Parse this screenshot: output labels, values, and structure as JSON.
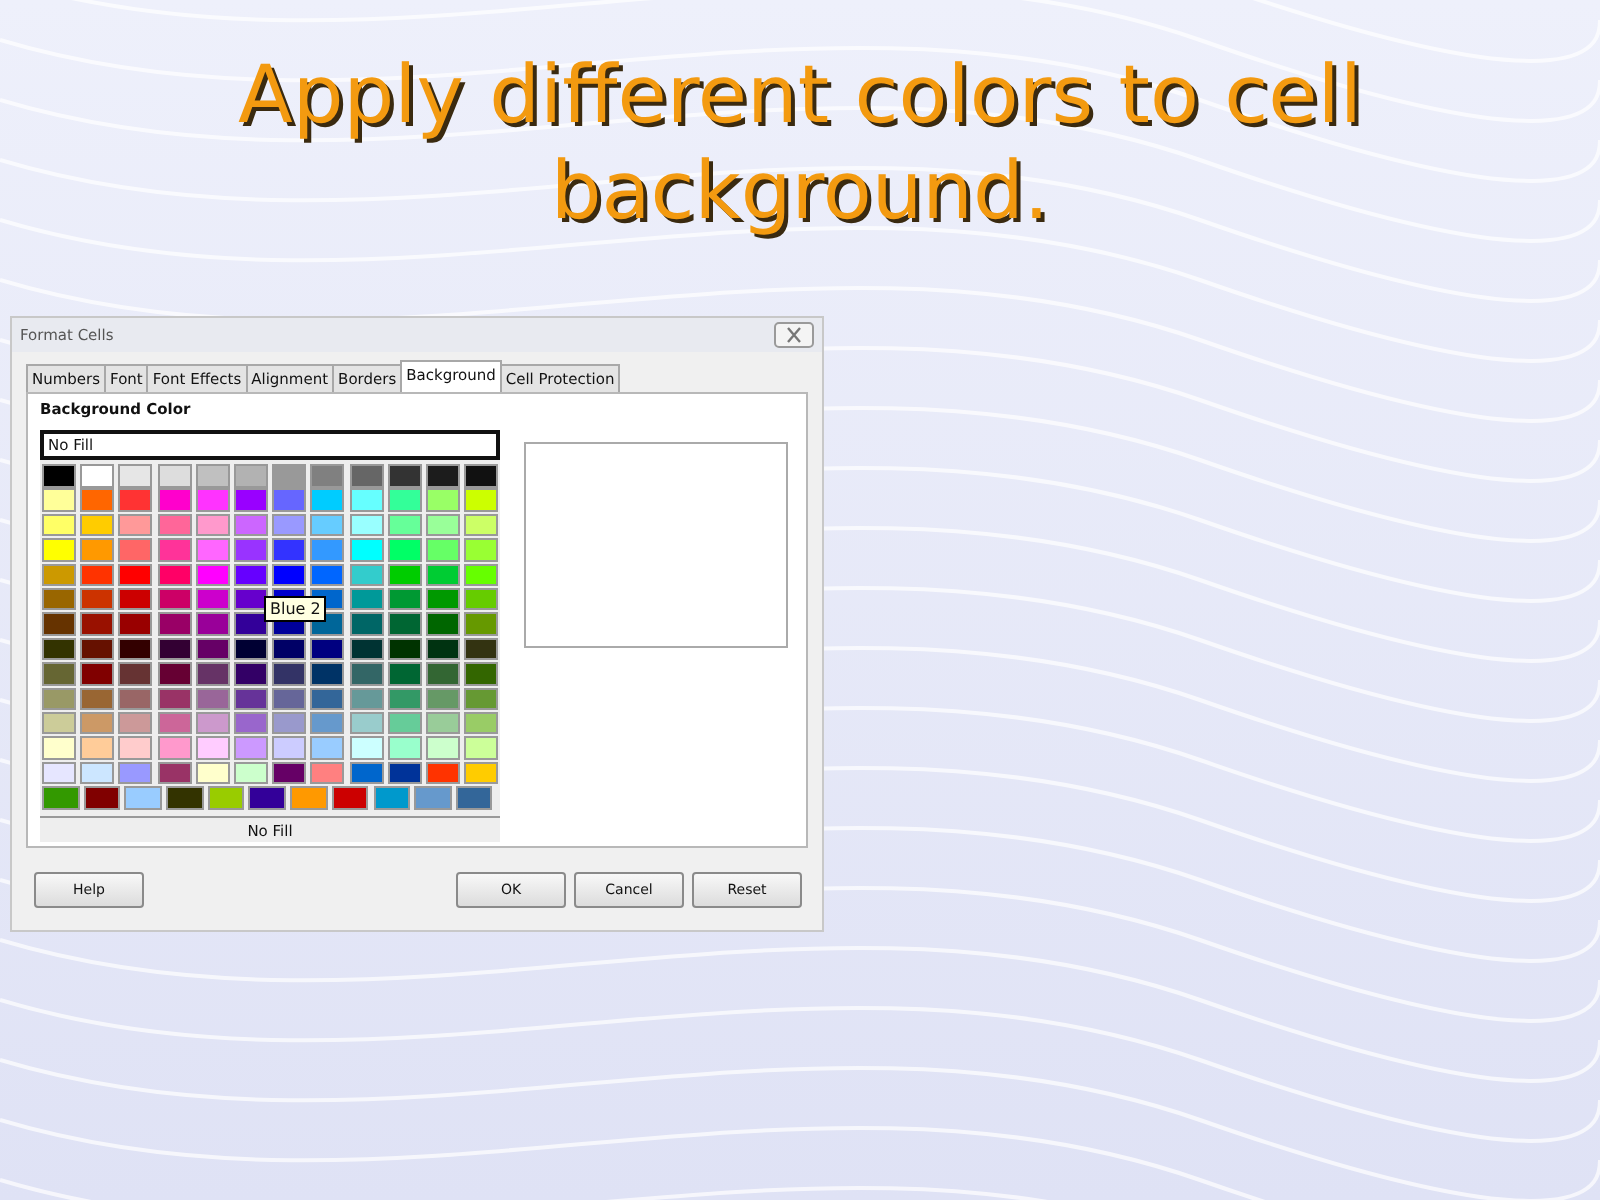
{
  "slide_title": "Apply different colors to cell background.",
  "dialog": {
    "title": "Format Cells",
    "tabs": [
      {
        "label": "Numbers",
        "selected": false
      },
      {
        "label": "Font",
        "selected": false
      },
      {
        "label": "Font Effects",
        "selected": false
      },
      {
        "label": "Alignment",
        "selected": false
      },
      {
        "label": "Borders",
        "selected": false
      },
      {
        "label": "Background",
        "selected": true
      },
      {
        "label": "Cell Protection",
        "selected": false
      }
    ],
    "section_title": "Background Color",
    "selected_color_name": "No Fill",
    "palette": [
      {
        "swatches": [
          {
            "color": "#000000"
          },
          {
            "color": "#ffffff"
          },
          {
            "color": "#e6e6e6"
          },
          {
            "color": "#dddddd"
          },
          {
            "color": "#c0c0c0"
          },
          {
            "color": "#b2b2b2"
          },
          {
            "color": "#999999"
          },
          {
            "color": "#808080"
          },
          {
            "color": "#666666"
          },
          {
            "color": "#333333"
          },
          {
            "color": "#1c1c1c"
          },
          {
            "color": "#111111"
          }
        ]
      },
      {
        "swatches": [
          {
            "color": "#ffff99"
          },
          {
            "color": "#ff6600"
          },
          {
            "color": "#ff3333"
          },
          {
            "color": "#ff00cc"
          },
          {
            "color": "#ff33ff"
          },
          {
            "color": "#9900ff"
          },
          {
            "color": "#6666ff"
          },
          {
            "color": "#00ccff"
          },
          {
            "color": "#66ffff"
          },
          {
            "color": "#33ff99"
          },
          {
            "color": "#99ff66"
          },
          {
            "color": "#ccff00"
          }
        ]
      },
      {
        "swatches": [
          {
            "color": "#ffff66"
          },
          {
            "color": "#ffcc00"
          },
          {
            "color": "#ff9999"
          },
          {
            "color": "#ff6699"
          },
          {
            "color": "#ff99cc"
          },
          {
            "color": "#cc66ff"
          },
          {
            "color": "#9999ff"
          },
          {
            "color": "#66ccff"
          },
          {
            "color": "#99ffff"
          },
          {
            "color": "#66ff99"
          },
          {
            "color": "#99ff99"
          },
          {
            "color": "#ccff66"
          }
        ]
      },
      {
        "swatches": [
          {
            "color": "#ffff00"
          },
          {
            "color": "#ff9900"
          },
          {
            "color": "#ff6666"
          },
          {
            "color": "#ff3399"
          },
          {
            "color": "#ff66ff"
          },
          {
            "color": "#9933ff"
          },
          {
            "color": "#3333ff"
          },
          {
            "color": "#3399ff"
          },
          {
            "color": "#00ffff"
          },
          {
            "color": "#00ff66"
          },
          {
            "color": "#66ff66"
          },
          {
            "color": "#99ff33"
          }
        ]
      },
      {
        "swatches": [
          {
            "color": "#cc9900"
          },
          {
            "color": "#ff3300"
          },
          {
            "color": "#ff0000"
          },
          {
            "color": "#ff0066"
          },
          {
            "color": "#ff00ff"
          },
          {
            "color": "#6600ff"
          },
          {
            "color": "#0000ff"
          },
          {
            "color": "#0066ff"
          },
          {
            "color": "#33cccc"
          },
          {
            "color": "#00cc00"
          },
          {
            "color": "#00cc33"
          },
          {
            "color": "#66ff00"
          }
        ]
      },
      {
        "swatches": [
          {
            "color": "#996600"
          },
          {
            "color": "#cc3300"
          },
          {
            "color": "#cc0000"
          },
          {
            "color": "#cc0066"
          },
          {
            "color": "#cc00cc"
          },
          {
            "color": "#6600cc"
          },
          {
            "color": "#0000cc"
          },
          {
            "color": "#0066cc"
          },
          {
            "color": "#009999"
          },
          {
            "color": "#009933"
          },
          {
            "color": "#009900"
          },
          {
            "color": "#66cc00"
          }
        ]
      },
      {
        "swatches": [
          {
            "color": "#663300"
          },
          {
            "color": "#991100"
          },
          {
            "color": "#990000"
          },
          {
            "color": "#990066"
          },
          {
            "color": "#990099"
          },
          {
            "color": "#330099"
          },
          {
            "color": "#000099"
          },
          {
            "color": "#006699"
          },
          {
            "color": "#006666"
          },
          {
            "color": "#006633"
          },
          {
            "color": "#006600"
          },
          {
            "color": "#669900"
          }
        ]
      },
      {
        "swatches": [
          {
            "color": "#333300"
          },
          {
            "color": "#661100"
          },
          {
            "color": "#330000"
          },
          {
            "color": "#330033"
          },
          {
            "color": "#660066"
          },
          {
            "color": "#000033"
          },
          {
            "color": "#000066"
          },
          {
            "color": "#000080"
          },
          {
            "color": "#003333"
          },
          {
            "color": "#003300"
          },
          {
            "color": "#003311"
          },
          {
            "color": "#333311"
          }
        ]
      },
      {
        "swatches": [
          {
            "color": "#666633"
          },
          {
            "color": "#800000"
          },
          {
            "color": "#663333"
          },
          {
            "color": "#660033"
          },
          {
            "color": "#663366"
          },
          {
            "color": "#330066"
          },
          {
            "color": "#333366"
          },
          {
            "color": "#003366"
          },
          {
            "color": "#336666"
          },
          {
            "color": "#006633"
          },
          {
            "color": "#336633"
          },
          {
            "color": "#336600"
          }
        ]
      },
      {
        "swatches": [
          {
            "color": "#999966"
          },
          {
            "color": "#996633"
          },
          {
            "color": "#996666"
          },
          {
            "color": "#993366"
          },
          {
            "color": "#996699"
          },
          {
            "color": "#663399"
          },
          {
            "color": "#666699"
          },
          {
            "color": "#336699"
          },
          {
            "color": "#669999"
          },
          {
            "color": "#339966"
          },
          {
            "color": "#669966"
          },
          {
            "color": "#669933"
          }
        ]
      },
      {
        "swatches": [
          {
            "color": "#cccc99"
          },
          {
            "color": "#cc9966"
          },
          {
            "color": "#cc9999"
          },
          {
            "color": "#cc6699"
          },
          {
            "color": "#cc99cc"
          },
          {
            "color": "#9966cc"
          },
          {
            "color": "#9999cc"
          },
          {
            "color": "#6699cc"
          },
          {
            "color": "#99cccc"
          },
          {
            "color": "#66cc99"
          },
          {
            "color": "#99cc99"
          },
          {
            "color": "#99cc66"
          }
        ]
      },
      {
        "swatches": [
          {
            "color": "#ffffcc"
          },
          {
            "color": "#ffcc99"
          },
          {
            "color": "#ffcccc"
          },
          {
            "color": "#ff99cc"
          },
          {
            "color": "#ffccff"
          },
          {
            "color": "#cc99ff"
          },
          {
            "color": "#ccccff"
          },
          {
            "color": "#99ccff"
          },
          {
            "color": "#ccffff"
          },
          {
            "color": "#99ffcc"
          },
          {
            "color": "#ccffcc"
          },
          {
            "color": "#ccff99"
          }
        ]
      },
      {
        "swatches": [
          {
            "color": "#e6e6ff"
          },
          {
            "color": "#cce6ff"
          },
          {
            "color": "#9999ff"
          },
          {
            "color": "#993366"
          },
          {
            "color": "#ffffcc"
          },
          {
            "color": "#ccffcc"
          },
          {
            "color": "#660066"
          },
          {
            "color": "#ff8080"
          },
          {
            "color": "#0066cc"
          },
          {
            "color": "#003399"
          },
          {
            "color": "#ff3300"
          },
          {
            "color": "#ffcc00"
          }
        ]
      },
      {
        "swatches": [
          {
            "color": "#339900"
          },
          {
            "color": "#800000"
          },
          {
            "color": "#99ccff"
          },
          {
            "color": "#333300"
          },
          {
            "color": "#99cc00"
          },
          {
            "color": "#330099"
          },
          {
            "color": "#ff9900"
          },
          {
            "color": "#cc0000"
          },
          {
            "color": "#0099cc"
          },
          {
            "color": "#6699cc"
          },
          {
            "color": "#336699"
          }
        ]
      }
    ],
    "tooltip": "Blue 2",
    "status_label": "No Fill",
    "buttons": [
      {
        "label": "Help",
        "kind": "left"
      },
      {
        "label": "OK",
        "kind": "right"
      },
      {
        "label": "Cancel",
        "kind": "right"
      },
      {
        "label": "Reset",
        "kind": "right"
      }
    ]
  }
}
